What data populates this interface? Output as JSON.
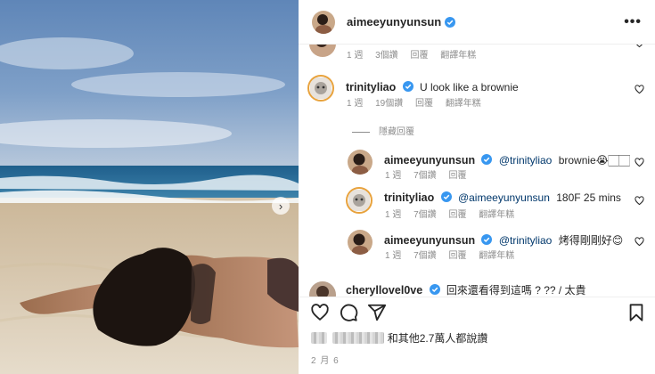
{
  "post": {
    "author": "aimeeyunyunsun",
    "more_icon": "more-horizontal-icon",
    "next_icon": "chevron-right-icon"
  },
  "comments": [
    {
      "user": "",
      "text": "",
      "meta": {
        "time": "1 週",
        "likes": "3個讚",
        "reply": "回覆",
        "translate": "翻譯年糕"
      }
    },
    {
      "user": "trinityliao",
      "text": "U look like a brownie",
      "meta": {
        "time": "1 週",
        "likes": "19個讚",
        "reply": "回覆",
        "translate": "翻譯年糕"
      },
      "hide_replies": "隱藏回覆"
    }
  ],
  "replies": [
    {
      "user": "aimeeyunyunsun",
      "mention": "@trinityliao",
      "text": "brownie😭🏻🏻",
      "meta": {
        "time": "1 週",
        "likes": "7個讚",
        "reply": "回覆"
      }
    },
    {
      "user": "trinityliao",
      "mention": "@aimeeyunyunsun",
      "text": "180F 25 mins",
      "meta": {
        "time": "1 週",
        "likes": "7個讚",
        "reply": "回覆",
        "translate": "翻譯年糕"
      }
    },
    {
      "user": "aimeeyunyunsun",
      "mention": "@trinityliao",
      "text": "烤得剛剛好😊",
      "meta": {
        "time": "1 週",
        "likes": "7個讚",
        "reply": "回覆",
        "translate": "翻譯年糕"
      }
    }
  ],
  "partial_comment": {
    "user": "cheryllovel0ve",
    "text": "回來還看得到這嗎 ?  ??  /  太貴"
  },
  "actions": {
    "icons": [
      "heart-icon",
      "comment-icon",
      "share-icon",
      "bookmark-icon"
    ]
  },
  "likes_text": "和其他2.7萬人都說讚",
  "date": "2 月 6",
  "colors": {
    "verified": "#3897f0",
    "mention": "#00376b",
    "meta": "#8e8e8e",
    "story_ring": "#e8a23c"
  }
}
